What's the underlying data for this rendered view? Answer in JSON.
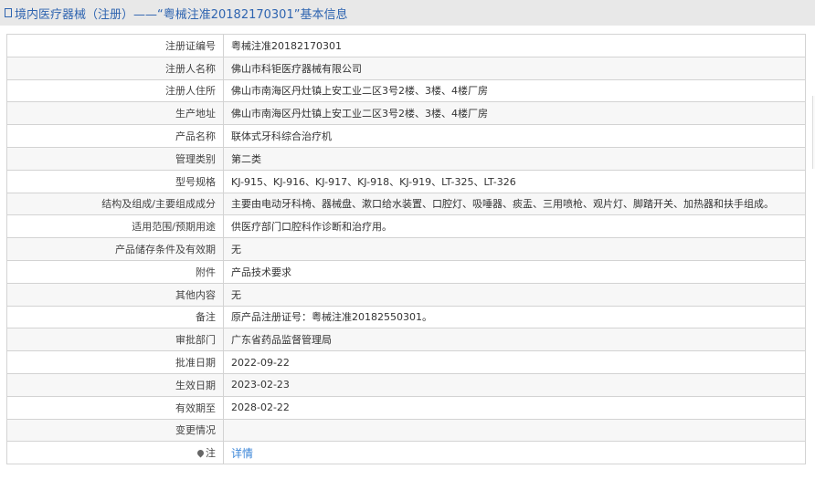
{
  "header": {
    "title": "境内医疗器械（注册）——“粤械注准20182170301”基本信息",
    "icon": "document-icon"
  },
  "rows": [
    {
      "label": "注册证编号",
      "value": "粤械注准20182170301"
    },
    {
      "label": "注册人名称",
      "value": "佛山市科钜医疗器械有限公司"
    },
    {
      "label": "注册人住所",
      "value": "佛山市南海区丹灶镇上安工业二区3号2楼、3楼、4楼厂房"
    },
    {
      "label": "生产地址",
      "value": "佛山市南海区丹灶镇上安工业二区3号2楼、3楼、4楼厂房"
    },
    {
      "label": "产品名称",
      "value": "联体式牙科综合治疗机"
    },
    {
      "label": "管理类别",
      "value": "第二类"
    },
    {
      "label": "型号规格",
      "value": "KJ-915、KJ-916、KJ-917、KJ-918、KJ-919、LT-325、LT-326"
    },
    {
      "label": "结构及组成/主要组成成分",
      "value": "主要由电动牙科椅、器械盘、漱口给水装置、口腔灯、吸唾器、痰盂、三用喷枪、观片灯、脚踏开关、加热器和扶手组成。"
    },
    {
      "label": "适用范围/预期用途",
      "value": "供医疗部门口腔科作诊断和治疗用。"
    },
    {
      "label": "产品储存条件及有效期",
      "value": "无"
    },
    {
      "label": "附件",
      "value": "产品技术要求"
    },
    {
      "label": "其他内容",
      "value": "无"
    },
    {
      "label": "备注",
      "value": "原产品注册证号：粤械注准20182550301。"
    },
    {
      "label": "审批部门",
      "value": "广东省药品监督管理局"
    },
    {
      "label": "批准日期",
      "value": "2022-09-22"
    },
    {
      "label": "生效日期",
      "value": "2023-02-23"
    },
    {
      "label": "有效期至",
      "value": "2028-02-22"
    },
    {
      "label": "变更情况",
      "value": ""
    }
  ],
  "note": {
    "label": "注",
    "link": "详情",
    "icon": "pin-icon"
  }
}
